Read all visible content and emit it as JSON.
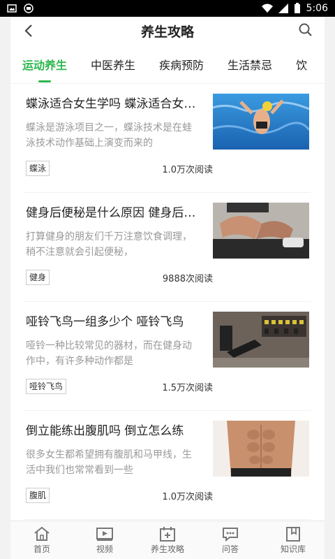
{
  "status": {
    "time": "5:06"
  },
  "header": {
    "title": "养生攻略"
  },
  "tabs": [
    {
      "label": "运动养生",
      "active": true
    },
    {
      "label": "中医养生"
    },
    {
      "label": "疾病预防"
    },
    {
      "label": "生活禁忌"
    },
    {
      "label": "饮"
    }
  ],
  "articles": [
    {
      "title": "蝶泳适合女生学吗 蝶泳适合女生学吗",
      "desc": "蝶泳是游泳项目之一，蝶泳技术是在蛙泳技术动作基础上演变而来的",
      "tag": "蝶泳",
      "reads": "1.0万次阅读",
      "image": "swimmer-photo"
    },
    {
      "title": "健身后便秘是什么原因 健身后便秘",
      "desc": "打算健身的朋友们千万注意饮食调理，稍不注意就会引起便秘，",
      "tag": "健身",
      "reads": "9888次阅读",
      "image": "fitness-legs-photo"
    },
    {
      "title": "哑铃飞鸟一组多少个 哑铃飞鸟",
      "desc": "哑铃一种比较常见的器材，而在健身动作中，有许多种动作都是",
      "tag": "哑铃飞鸟",
      "reads": "1.5万次阅读",
      "image": "gym-photo"
    },
    {
      "title": "倒立能练出腹肌吗 倒立怎么练",
      "desc": "很多女生都希望拥有腹肌和马甲线，生活中我们也常常看到一些",
      "tag": "腹肌",
      "reads": "1.0万次阅读",
      "image": "abs-photo"
    }
  ],
  "bottom_nav": [
    {
      "label": "首页",
      "icon": "home-icon"
    },
    {
      "label": "视频",
      "icon": "video-icon"
    },
    {
      "label": "养生攻略",
      "icon": "calendar-plus-icon"
    },
    {
      "label": "问答",
      "icon": "chat-icon"
    },
    {
      "label": "知识库",
      "icon": "book-icon"
    }
  ],
  "colors": {
    "accent": "#2db84d"
  }
}
